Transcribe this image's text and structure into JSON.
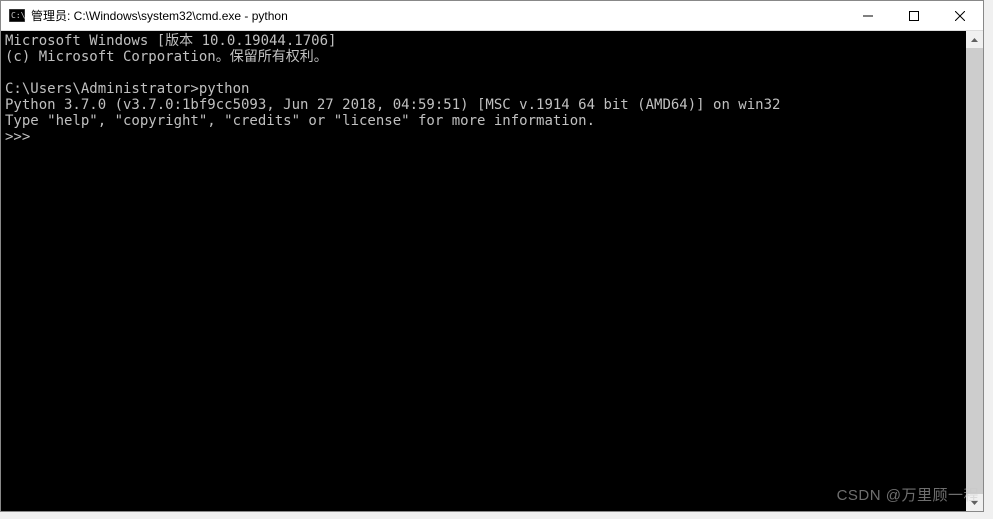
{
  "titlebar": {
    "title": "管理员: C:\\Windows\\system32\\cmd.exe - python"
  },
  "terminal": {
    "line1": "Microsoft Windows [版本 10.0.19044.1706]",
    "line2": "(c) Microsoft Corporation。保留所有权利。",
    "blank1": "",
    "prompt_line": "C:\\Users\\Administrator>python",
    "python_line1": "Python 3.7.0 (v3.7.0:1bf9cc5093, Jun 27 2018, 04:59:51) [MSC v.1914 64 bit (AMD64)] on win32",
    "python_line2": "Type \"help\", \"copyright\", \"credits\" or \"license\" for more information.",
    "repl_prompt": ">>> "
  },
  "watermark": "CSDN @万里顾一程"
}
